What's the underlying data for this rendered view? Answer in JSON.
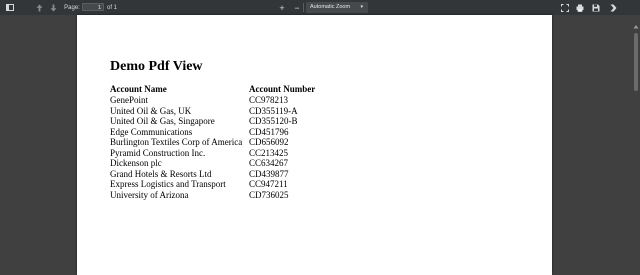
{
  "toolbar": {
    "page_label": "Page:",
    "page_value": "1",
    "page_of": "of 1",
    "zoom_out": "−",
    "zoom_in": "+",
    "zoom_value": "Automatic Zoom",
    "zoom_caret": "▾",
    "icons": [
      "sidebar-toggle",
      "previous-page",
      "next-page",
      "zoom-out",
      "zoom-in",
      "presentation-mode",
      "print",
      "download",
      "more-tools"
    ]
  },
  "document": {
    "title": "Demo Pdf View",
    "headers": {
      "name": "Account Name",
      "number": "Account Number"
    },
    "rows": [
      {
        "name": "GenePoint",
        "number": "CC978213"
      },
      {
        "name": "United Oil & Gas, UK",
        "number": "CD355119-A"
      },
      {
        "name": "United Oil & Gas, Singapore",
        "number": "CD355120-B"
      },
      {
        "name": "Edge Communications",
        "number": "CD451796"
      },
      {
        "name": "Burlington Textiles Corp of America",
        "number": "CD656092"
      },
      {
        "name": "Pyramid Construction Inc.",
        "number": "CC213425"
      },
      {
        "name": "Dickenson plc",
        "number": "CC634267"
      },
      {
        "name": "Grand Hotels & Resorts Ltd",
        "number": "CD439877"
      },
      {
        "name": "Express Logistics and Transport",
        "number": "CC947211"
      },
      {
        "name": "University of Arizona",
        "number": "CD736025"
      }
    ]
  },
  "colors": {
    "toolbar": "#323639",
    "viewer_bg": "#404040",
    "page": "#ffffff"
  }
}
